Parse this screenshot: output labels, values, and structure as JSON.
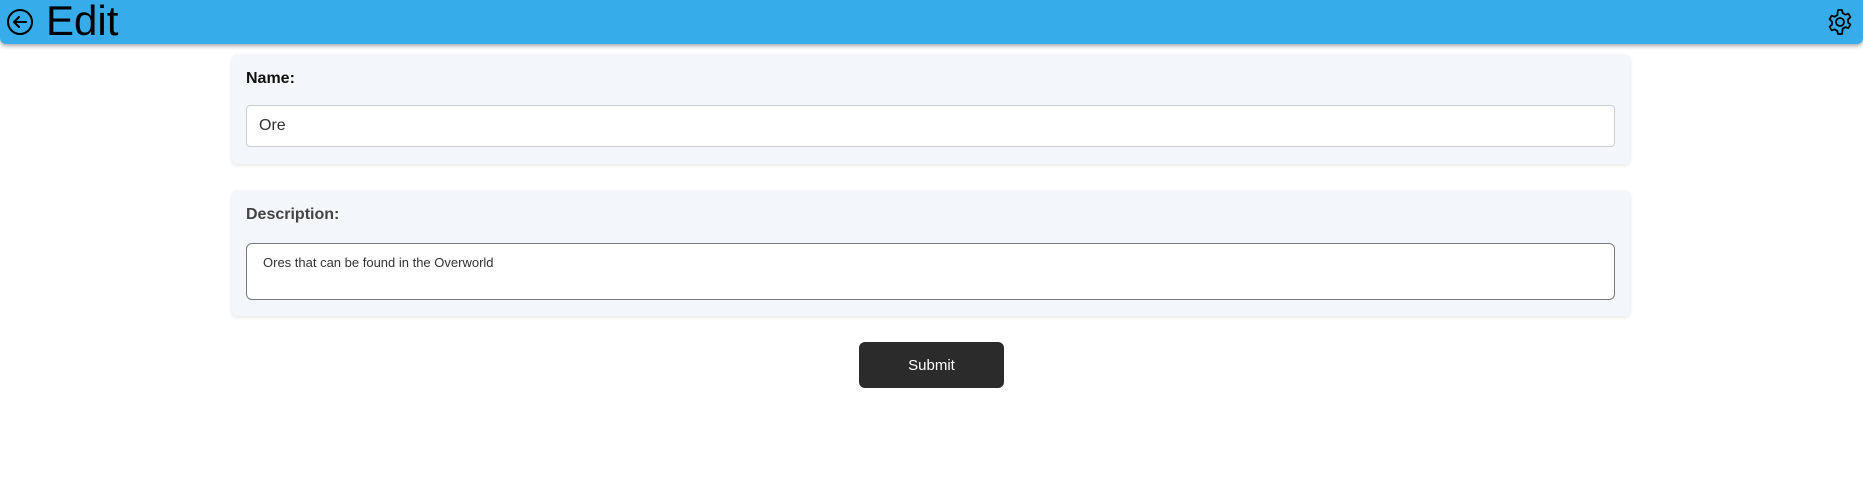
{
  "header": {
    "title": "Edit",
    "back_icon": "arrow-left-circle-icon",
    "settings_icon": "gear-icon",
    "background_color": "#36adea"
  },
  "form": {
    "name": {
      "label": "Name:",
      "value": "Ore"
    },
    "description": {
      "label": "Description:",
      "value": "Ores that can be found in the Overworld"
    },
    "submit_label": "Submit",
    "card_background_color": "#f3f6fb",
    "button_color": "#2b2b2b"
  }
}
